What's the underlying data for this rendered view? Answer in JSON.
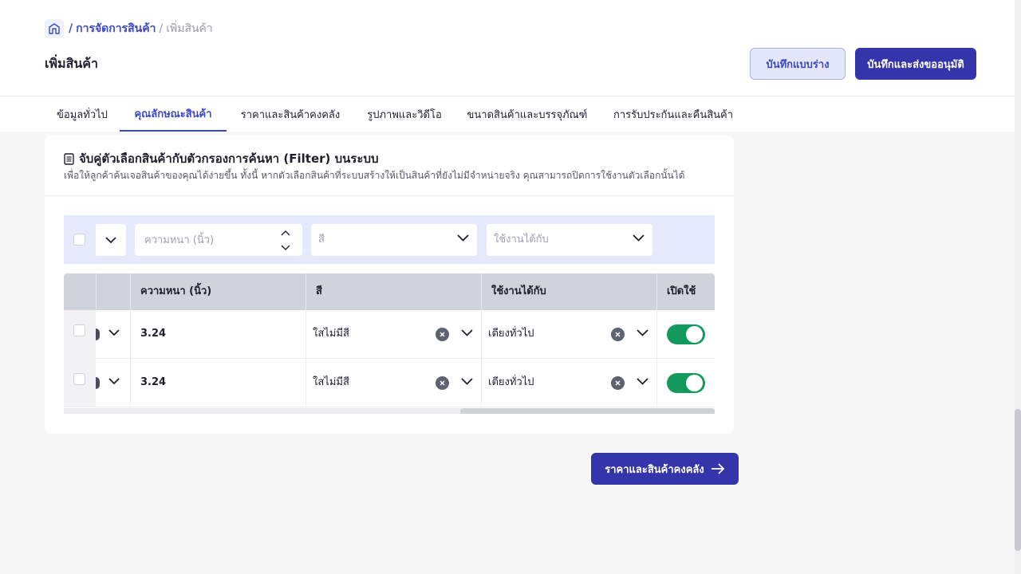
{
  "breadcrumb": {
    "separator": "/",
    "parent": "การจัดการสินค้า",
    "current": "เพิ่มสินค้า"
  },
  "header": {
    "title": "เพิ่มสินค้า",
    "save_draft_label": "บันทึกแบบร่าง",
    "save_submit_label": "บันทึกและส่งขออนุมัติ"
  },
  "tabs": [
    {
      "label": "ข้อมูลทั่วไป",
      "active": false
    },
    {
      "label": "คุณลักษณะสินค้า",
      "active": true
    },
    {
      "label": "ราคาและสินค้าคงคลัง",
      "active": false
    },
    {
      "label": "รูปภาพและวิดีโอ",
      "active": false
    },
    {
      "label": "ขนาดสินค้าและบรรจุภัณฑ์",
      "active": false
    },
    {
      "label": "การรับประกันและคืนสินค้า",
      "active": false
    }
  ],
  "card": {
    "title": "จับคู่ตัวเลือกสินค้ากับตัวกรองการค้นหา (Filter) บนระบบ",
    "description": "เพื่อให้ลูกค้าค้นเจอสินค้าของคุณได้ง่ายขึ้น ทั้งนี้ หากตัวเลือกสินค้าที่ระบบสร้างให้เป็นสินค้าที่ยังไม่มีจำหน่ายจริง คุณสามารถปิดการใช้งานตัวเลือกนั้นได้"
  },
  "filter_bar": {
    "thickness_placeholder": "ความหนา (นิ้ว)",
    "color_placeholder": "สี",
    "compatible_placeholder": "ใช้งานได้กับ"
  },
  "table": {
    "headers": {
      "thickness": "ความหนา (นิ้ว)",
      "color": "สี",
      "compatible": "ใช้งานได้กับ",
      "enabled": "เปิดใช้"
    },
    "rows": [
      {
        "thickness": "3.24",
        "color": "ใสไม่มีสี",
        "compatible": "เตียงทั่วไป",
        "enabled": true
      },
      {
        "thickness": "3.24",
        "color": "ใสไม่มีสี",
        "compatible": "เตียงทั่วไป",
        "enabled": true
      }
    ]
  },
  "next_button_label": "ราคาและสินค้าคงคลัง",
  "colors": {
    "primary": "#3535ab",
    "link": "#3b48c6",
    "toggle_on": "#129a5c",
    "filter_bg": "#e6e9fb"
  }
}
